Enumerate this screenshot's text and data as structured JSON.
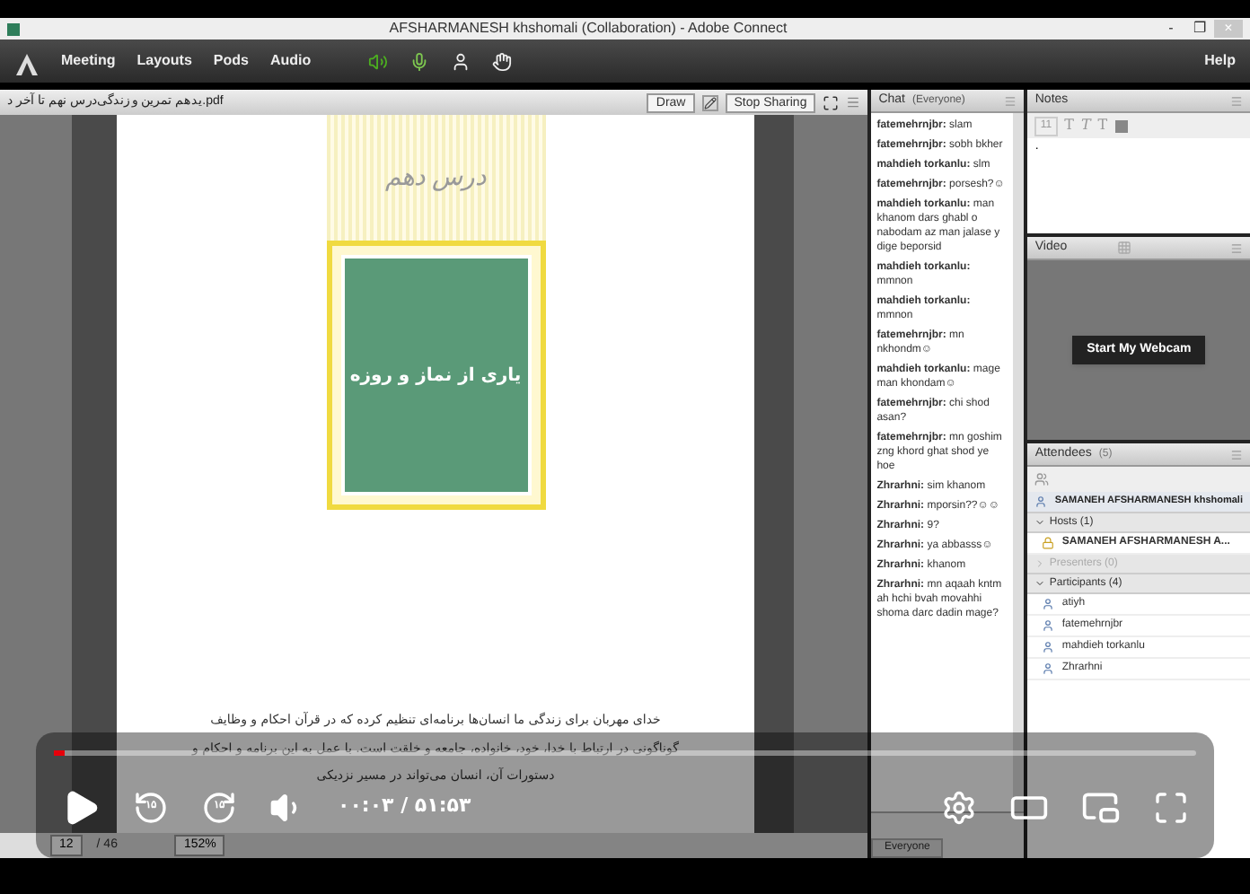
{
  "window": {
    "title": "AFSHARMANESH khshomali (Collaboration) - Adobe Connect",
    "controls": [
      "-",
      "❐",
      "×"
    ]
  },
  "menu": {
    "items": [
      "Meeting",
      "Layouts",
      "Pods",
      "Audio"
    ],
    "help": "Help"
  },
  "share_pod": {
    "filename": "یدهم تمرین و زندگی‌درس نهم تا آخر د.pdf",
    "buttons": [
      "Draw",
      "Stop Sharing"
    ],
    "slide": {
      "heading": "درس دهم",
      "card_title": "یاری از نماز و روزه",
      "paragraph": [
        "خدای مهربان برای زندگی ما انسان‌ها برنامه‌ای تنظیم کرده که در قرآن احکام و وظایف",
        "گوناگونی در ارتباط با خدا، خود، خانواده، جامعه و خلقت است. با عمل به این برنامه و احکام و",
        "دستورات آن، انسان می‌تواند در مسیر نزدیکی"
      ]
    },
    "page": "12",
    "page_count": "/ 46",
    "zoom": "152%"
  },
  "chat": {
    "title": "Chat",
    "scope": "(Everyone)",
    "recipient": "Everyone",
    "messages": [
      {
        "text": "**fatemehrnjbr:** slam"
      },
      {
        "text": "**fatemehrnjbr:** sobh bkher"
      },
      {
        "text": "**mahdieh torkanlu:** slm"
      },
      {
        "text": "**fatemehrnjbr:** porsesh?☺"
      },
      {
        "text": "**mahdieh torkanlu:** man khanom dars ghabl o nabodam az man jalase y dige beporsid"
      },
      {
        "text": "**mahdieh torkanlu:** mmnon"
      },
      {
        "text": "**mahdieh torkanlu:** mmnon"
      },
      {
        "text": "**fatemehrnjbr:** mn nkhondm☺"
      },
      {
        "text": "**mahdieh torkanlu:** mage man khondam☺"
      },
      {
        "text": "**fatemehrnjbr:** chi shod asan?"
      },
      {
        "text": "**fatemehrnjbr:** mn goshim zng khord ghat shod ye hoe"
      },
      {
        "text": "**Zhrarhni:** sim khanom"
      },
      {
        "text": "**Zhrarhni:** mporsin??☺☺"
      },
      {
        "text": "**Zhrarhni:** 9?"
      },
      {
        "text": "**Zhrarhni:** ya abbasss☺"
      },
      {
        "text": "**Zhrarhni:** khanom"
      },
      {
        "text": "**Zhrarhni:** mn aqaah kntm ah hchi bvah movahhi shoma darc dadin mage?"
      }
    ]
  },
  "notes": {
    "title": "Notes",
    "font_size": "11",
    "format_buttons": [
      "T",
      "T",
      "T"
    ],
    "text": "."
  },
  "video": {
    "title": "Video",
    "button": "Start My Webcam"
  },
  "attendees": {
    "title": "Attendees",
    "count": "(5)",
    "me": "SAMANEH AFSHARMANESH khshomali",
    "groups": [
      {
        "label": "Hosts (1)",
        "expanded": true,
        "people": [
          "SAMANEH AFSHARMANESH A..."
        ]
      },
      {
        "label": "Presenters (0)",
        "expanded": false
      },
      {
        "label": "Participants (4)",
        "expanded": true,
        "people": [
          "atiyh",
          "fatemehrnjbr",
          "mahdieh torkanlu",
          "Zhrarhni"
        ]
      }
    ]
  },
  "player": {
    "level": 0.01,
    "rewind": "۱۵",
    "forward": "۱۵",
    "time": "۰۰:۰۳ / ۵۱:۵۳"
  }
}
